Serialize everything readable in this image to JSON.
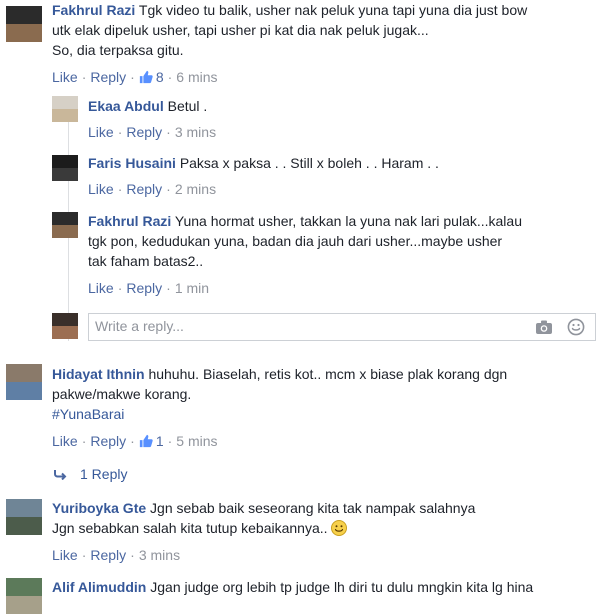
{
  "actions": {
    "like": "Like",
    "reply": "Reply",
    "sep": "·"
  },
  "comments": [
    {
      "name": "Fakhrul Razi",
      "text_line1": "Tgk video tu balik, usher nak peluk yuna tapi yuna dia just bow",
      "text_line2": "utk elak dipeluk usher, tapi usher pi kat dia nak peluk jugak...",
      "text_line3": "So, dia terpaksa gitu.",
      "likes": "8",
      "time": "6 mins",
      "avatar_colors": [
        "#2b2b2b",
        "#8a6b4f"
      ]
    },
    {
      "name": "Ekaa Abdul",
      "text_line1": "Betul .",
      "time": "3 mins",
      "avatar_colors": [
        "#d6d0c6",
        "#c9b79a"
      ]
    },
    {
      "name": "Faris Husaini",
      "text_line1": "Paksa x paksa . . Still x boleh . . Haram . .",
      "time": "2 mins",
      "avatar_colors": [
        "#1c1c1c",
        "#3a3a3a"
      ]
    },
    {
      "name": "Fakhrul Razi",
      "text_line1": "Yuna hormat usher, takkan la yuna nak lari pulak...kalau",
      "text_line2": "tgk pon, kedudukan yuna, badan dia jauh dari usher...maybe usher",
      "text_line3": "tak faham batas2..",
      "time": "1 min",
      "avatar_colors": [
        "#2b2b2b",
        "#8a6b4f"
      ]
    },
    {
      "name": "Hidayat Ithnin",
      "text_line1": "huhuhu. Biaselah, retis kot.. mcm x biase plak korang dgn",
      "text_line2": "pakwe/makwe korang.",
      "hashtag": "#YunaBarai",
      "likes": "1",
      "time": "5 mins",
      "avatar_colors": [
        "#8a7a6a",
        "#5f7fa5"
      ]
    },
    {
      "name": "Yuriboyka Gte",
      "text_line1": "Jgn sebab baik seseorang kita tak nampak salahnya",
      "text_line2": "Jgn sebabkan salah kita tutup kebaikannya..",
      "time": "3 mins",
      "avatar_colors": [
        "#6f8596",
        "#4c5c4b"
      ]
    },
    {
      "name": "Alif Alimuddin",
      "text_line1": "Jgan judge org lebih tp judge lh diri tu dulu mngkin kita lg hina",
      "avatar_colors": [
        "#5c7a5a",
        "#a6a08a"
      ]
    }
  ],
  "reply_box": {
    "placeholder": "Write a reply...",
    "avatar_colors": [
      "#3a2f2a",
      "#9c6e52"
    ]
  },
  "replies_toggle": {
    "label": "1 Reply"
  },
  "colors": {
    "link": "#365899",
    "meta": "#90949c",
    "like_blue": "#4b67a1"
  },
  "icons": [
    "thumbs-up-icon",
    "camera-icon",
    "smiley-icon",
    "reply-arrow-icon",
    "smiley-emoji-icon"
  ]
}
